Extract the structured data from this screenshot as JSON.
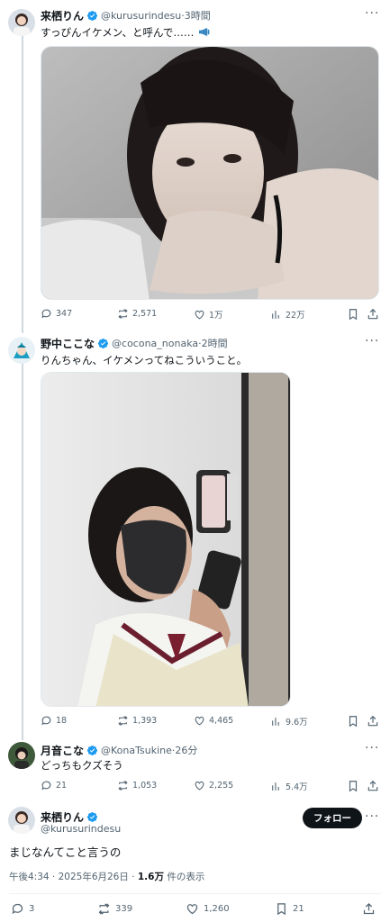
{
  "tweets": [
    {
      "name": "来栖りん",
      "handle": "@kurusurindesu",
      "time": "3時間",
      "text": "すっぴんイケメン、と呼んで……",
      "stats": {
        "replies": "347",
        "retweets": "2,571",
        "likes": "1万",
        "views": "22万"
      }
    },
    {
      "name": "野中ここな",
      "handle": "@cocona_nonaka",
      "time": "2時間",
      "text": "りんちゃん、イケメンってねこういうこと。",
      "stats": {
        "replies": "18",
        "retweets": "1,393",
        "likes": "4,465",
        "views": "9.6万"
      }
    },
    {
      "name": "月音こな",
      "handle": "@KonaTsukine",
      "time": "26分",
      "text": "どっちもクズそう",
      "stats": {
        "replies": "21",
        "retweets": "1,053",
        "likes": "2,255",
        "views": "5.4万"
      }
    }
  ],
  "main_tweet": {
    "name": "来栖りん",
    "handle": "@kurusurindesu",
    "follow_label": "フォロー",
    "text": "まじなんてこと言うの",
    "timestamp": "午後4:34 · 2025年6月26日 · ",
    "views_count": "1.6万",
    "views_label": " 件の表示",
    "stats": {
      "replies": "3",
      "retweets": "339",
      "likes": "1,260",
      "bookmarks": "21"
    }
  },
  "separator": " · ",
  "more_glyph": "···",
  "colors": {
    "verified": "#1d9bf0",
    "text": "#0f1419",
    "secondary": "#536471",
    "follow_bg": "#0f1419"
  }
}
